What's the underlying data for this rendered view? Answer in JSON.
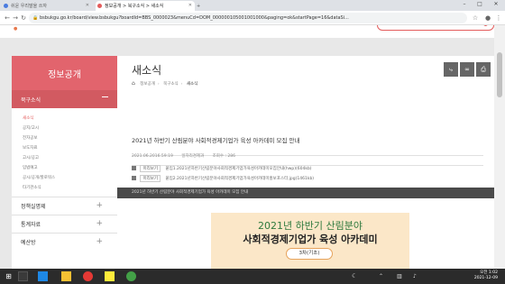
{
  "browser": {
    "tabs": [
      {
        "label": "쉬운 우리말을 쓰자",
        "color": "#4a7be0"
      },
      {
        "label": "정보공개 > 북구소식 > 새소식",
        "color": "#e35c5c"
      }
    ],
    "url": "bsbukgu.go.kr/board/view.bsbukgu?boardId=BBS_0000023&menuCd=DOM_000000105001001000&paging=ok&startPage=16&dataSi..."
  },
  "sidebar": {
    "title": "정보공개",
    "section": "북구소식",
    "sub_items": [
      "새소식",
      "공지/고시",
      "전자공보",
      "보도자료",
      "고시/공고",
      "입법예고",
      "공시/공개/할로워스",
      "타기관소식"
    ],
    "sections": [
      "정책실명제",
      "통계자료",
      "예산방"
    ]
  },
  "main": {
    "page_title": "새소식",
    "breadcrumb": [
      "정보공개",
      "북구소식",
      "새소식"
    ],
    "post_title": "2021년 하반기 산림분야 사회적경제기업가 육성 아카데미 모집 안내",
    "meta": {
      "date": "2021.06.2016.59:19",
      "author": "일자리경제과",
      "views_label": "조회수 : 286"
    },
    "attachments": [
      {
        "preview": "미리보기",
        "name": "붙임1.2021년하반기산림분야사회적경제기업가육성아카데미모집안내(hwp)(604kb)"
      },
      {
        "preview": "미리보기",
        "name": "붙임2.2021년하반기산림분야사회적경제기업가육성아카데미홍보포스터.jpg(1461kb)"
      }
    ],
    "dark_bar_text": "2021년 하반기 산림분야 사회적경제기업가 육성 아카데미 모집 안내",
    "poster": {
      "line1": "2021년 하반기 산림분야",
      "line2": "사회적경제기업가 육성 아카데미",
      "tag": "3차(기초)"
    }
  },
  "taskbar": {
    "time_line1": "오전 1:02",
    "time_line2": "2021-12-09"
  },
  "colors": {
    "accent": "#e2646d",
    "poster_green": "#2e7a3d"
  }
}
